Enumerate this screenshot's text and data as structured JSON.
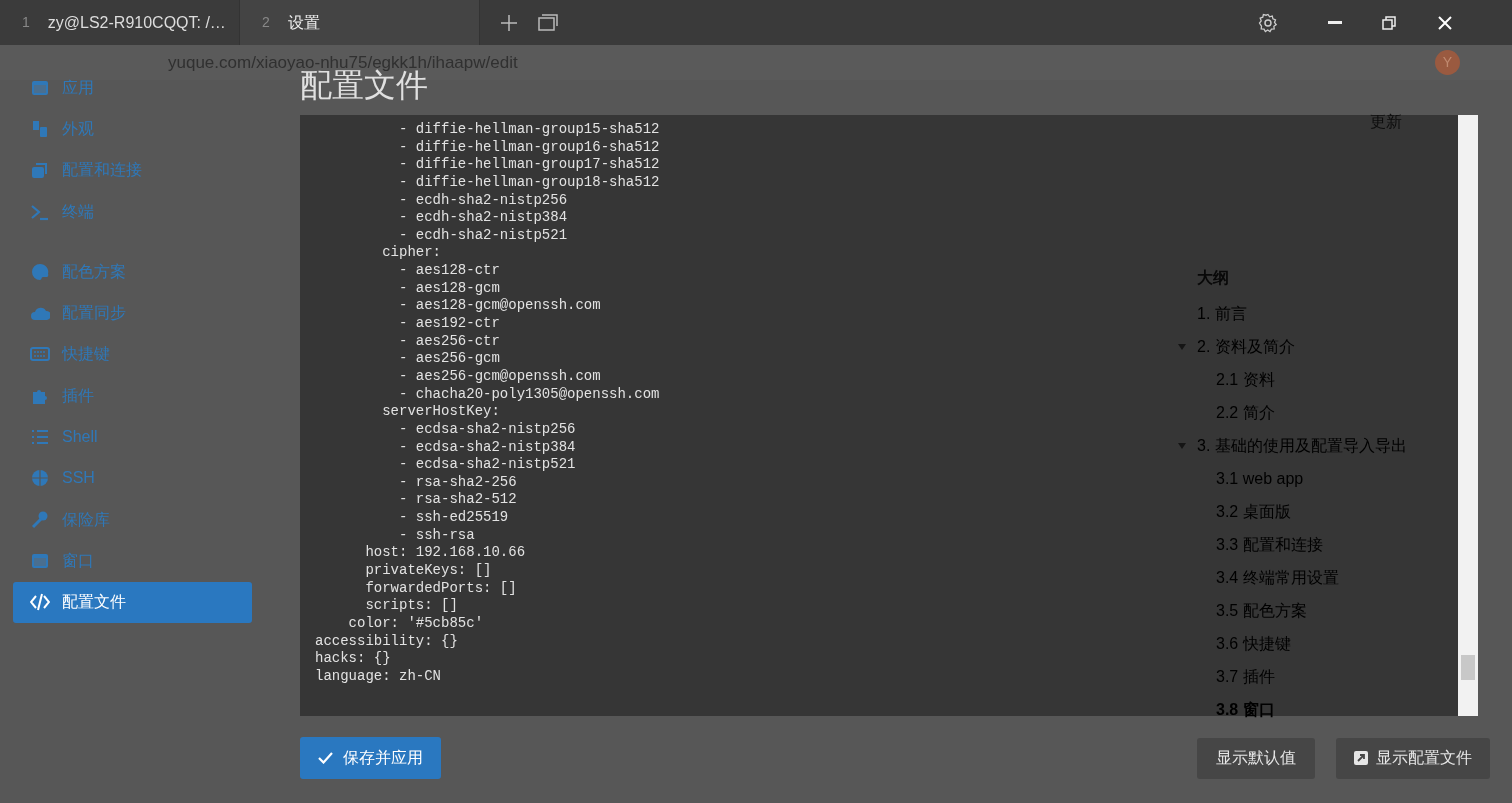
{
  "tabs": [
    {
      "index": "1",
      "label": "zy@LS2-R910CQQT: /…",
      "selected": false
    },
    {
      "index": "2",
      "label": "设置",
      "selected": true
    }
  ],
  "browser_background": {
    "url": "yuque.com/xiaoyao-nhu75/egkk1h/ihaapw/edit",
    "update_label": "更新",
    "avatar": "Y",
    "outline": {
      "title": "大纲",
      "items": [
        {
          "label": "1. 前言",
          "selected": false
        },
        {
          "label": "2. 资料及简介",
          "selected": false,
          "children": [
            {
              "label": "2.1 资料",
              "selected": false
            },
            {
              "label": "2.2 简介",
              "selected": false
            }
          ]
        },
        {
          "label": "3. 基础的使用及配置导入导出",
          "selected": false,
          "children": [
            {
              "label": "3.1 web app",
              "selected": false
            },
            {
              "label": "3.2 桌面版",
              "selected": false
            },
            {
              "label": "3.3 配置和连接",
              "selected": false
            },
            {
              "label": "3.4 终端常用设置",
              "selected": false
            },
            {
              "label": "3.5 配色方案",
              "selected": false
            },
            {
              "label": "3.6 快捷键",
              "selected": false
            },
            {
              "label": "3.7 插件",
              "selected": false
            },
            {
              "label": "3.8 窗口",
              "selected": true
            }
          ]
        }
      ]
    }
  },
  "sidebar": {
    "groups": [
      [
        {
          "label": "应用",
          "selected": false
        },
        {
          "label": "外观",
          "selected": false
        },
        {
          "label": "配置和连接",
          "selected": false
        },
        {
          "label": "终端",
          "selected": false
        }
      ],
      [
        {
          "label": "配色方案",
          "selected": false
        },
        {
          "label": "配置同步",
          "selected": false
        },
        {
          "label": "快捷键",
          "selected": false
        },
        {
          "label": "插件",
          "selected": false
        },
        {
          "label": "Shell",
          "selected": false
        },
        {
          "label": "SSH",
          "selected": false
        },
        {
          "label": "保险库",
          "selected": false
        },
        {
          "label": "窗口",
          "selected": false
        },
        {
          "label": "配置文件",
          "selected": true
        }
      ]
    ]
  },
  "page_title": "配置文件",
  "config_lines": [
    "          - diffie-hellman-group15-sha512",
    "          - diffie-hellman-group16-sha512",
    "          - diffie-hellman-group17-sha512",
    "          - diffie-hellman-group18-sha512",
    "          - ecdh-sha2-nistp256",
    "          - ecdh-sha2-nistp384",
    "          - ecdh-sha2-nistp521",
    "        cipher:",
    "          - aes128-ctr",
    "          - aes128-gcm",
    "          - aes128-gcm@openssh.com",
    "          - aes192-ctr",
    "          - aes256-ctr",
    "          - aes256-gcm",
    "          - aes256-gcm@openssh.com",
    "          - chacha20-poly1305@openssh.com",
    "        serverHostKey:",
    "          - ecdsa-sha2-nistp256",
    "          - ecdsa-sha2-nistp384",
    "          - ecdsa-sha2-nistp521",
    "          - rsa-sha2-256",
    "          - rsa-sha2-512",
    "          - ssh-ed25519",
    "          - ssh-rsa",
    "      host: 192.168.10.66",
    "      privateKeys: []",
    "      forwardedPorts: []",
    "      scripts: []",
    "    color: '#5cb85c'",
    "accessibility: {}",
    "hacks: {}",
    "language: zh-CN"
  ],
  "buttons": {
    "save": "保存并应用",
    "show_defaults": "显示默认值",
    "show_config_file": "显示配置文件"
  }
}
